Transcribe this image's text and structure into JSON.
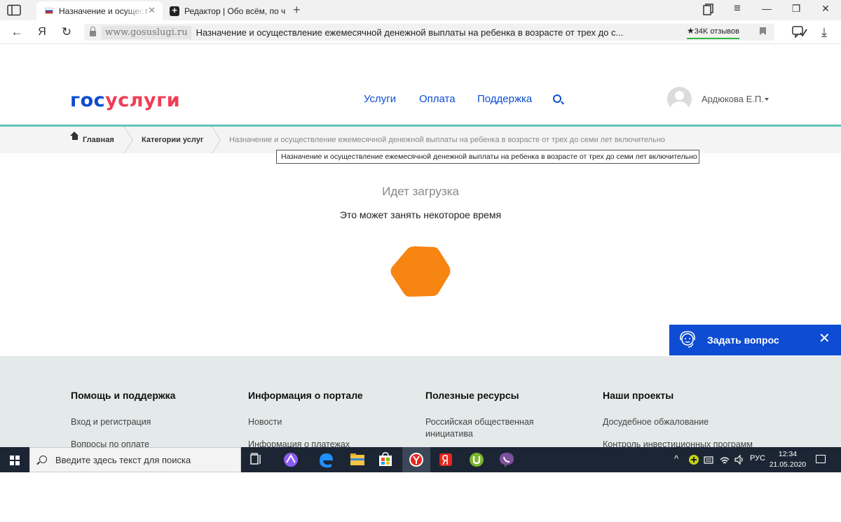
{
  "browser": {
    "tabs": [
      {
        "label": "Назначение и осуществ",
        "active": true
      },
      {
        "label": "Редактор | Обо всём, по ч",
        "active": false
      }
    ],
    "new_tab": "+",
    "address": {
      "domain": "www.gosuslugi.ru",
      "title": "Назначение и осуществление ежемесячной денежной выплаты на ребенка в возрасте от трех до с...",
      "reviews": "34K отзывов",
      "reviews_star": "★"
    },
    "icons": {
      "back": "←",
      "yandex": "Я",
      "reload": "↻",
      "close_tab": "✕",
      "minimize": "—",
      "restore": "❐",
      "close": "✕",
      "menu": "≡",
      "download": "⤓"
    }
  },
  "site": {
    "logo": {
      "part1": "гос",
      "part2": "услуги"
    },
    "nav": [
      "Услуги",
      "Оплата",
      "Поддержка"
    ],
    "user": "Ардюкова Е.П.",
    "breadcrumbs": [
      "Главная",
      "Категории услуг",
      "Назначение и осуществление ежемесячной денежной выплаты на ребенка в возрасте от трех до семи лет включительно"
    ],
    "tooltip": "Назначение и осуществление ежемесячной денежной выплаты на ребенка в возрасте от трех до семи лет включительно",
    "loading": {
      "title": "Идет загрузка",
      "subtitle": "Это может занять некоторое время"
    },
    "ask": {
      "label": "Задать вопрос",
      "close": "✕"
    },
    "footer": [
      {
        "heading": "Помощь и поддержка",
        "links": [
          "Вход и регистрация",
          "Вопросы по оплате"
        ]
      },
      {
        "heading": "Информация о портале",
        "links": [
          "Новости",
          "Информация о платежах"
        ]
      },
      {
        "heading": "Полезные ресурсы",
        "links": [
          "Российская общественная инициатива"
        ]
      },
      {
        "heading": "Наши проекты",
        "links": [
          "Досудебное обжалование",
          "Контроль инвестиционных программ"
        ]
      }
    ],
    "colors": {
      "brand_blue": "#0d4cd3",
      "brand_red": "#ee3f58",
      "teal": "#65c3b8",
      "spinner": "#f68512"
    }
  },
  "taskbar": {
    "search_placeholder": "Введите здесь текст для поиска",
    "lang": "РУС",
    "time": "12:34",
    "date": "21.05.2020",
    "tray_up": "^"
  }
}
